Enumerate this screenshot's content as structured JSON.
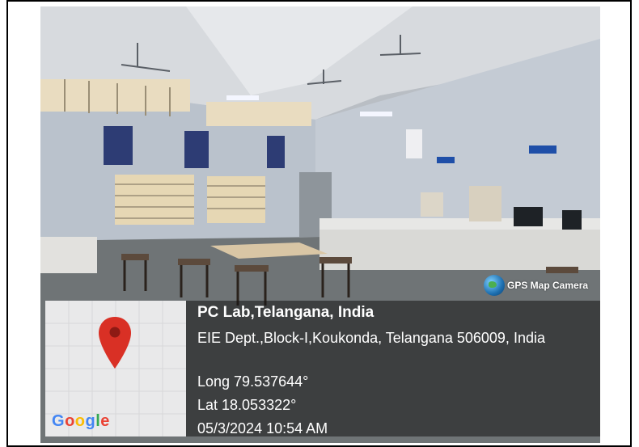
{
  "gps_badge": {
    "label": "GPS Map Camera"
  },
  "map": {
    "logo_letters": [
      "G",
      "o",
      "o",
      "g",
      "l",
      "e"
    ],
    "logo_colors": [
      "#4285F4",
      "#EA4335",
      "#FBBC05",
      "#4285F4",
      "#34A853",
      "#EA4335"
    ],
    "pin_color": "#d93025"
  },
  "location": {
    "title": "PC Lab,Telangana, India",
    "address": "EIE Dept.,Block-I,Koukonda, Telangana 506009, India",
    "longitude": "Long 79.537644°",
    "latitude": "Lat 18.053322°",
    "timestamp": "05/3/2024 10:54 AM"
  }
}
